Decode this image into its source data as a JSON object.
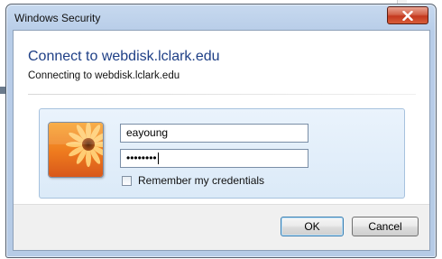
{
  "window": {
    "title": "Windows Security"
  },
  "dialog": {
    "heading": "Connect to webdisk.lclark.edu",
    "subheading": "Connecting to webdisk.lclark.edu"
  },
  "credentials": {
    "username": "eayoung",
    "password_mask": "••••••••",
    "remember_label": "Remember my credentials",
    "remember_checked": false
  },
  "buttons": {
    "ok": "OK",
    "cancel": "Cancel"
  },
  "icons": {
    "close": "close-icon",
    "avatar": "user-tile-flower-icon"
  },
  "colors": {
    "heading": "#1e3f86",
    "close_button": "#c4381f",
    "tile_border": "#a7c2de"
  }
}
